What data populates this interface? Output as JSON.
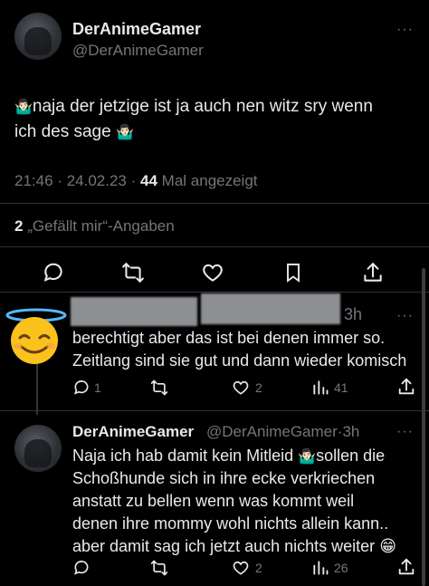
{
  "main_tweet": {
    "author_name": "DerAnimeGamer",
    "author_handle": "@DerAnimeGamer",
    "text_part1": "naja der jetzige ist ja auch nen witz sry wenn",
    "text_part2": "ich des sage",
    "emoji": "🤷🏻‍♂️",
    "time": "21:46",
    "date": "24.02.23",
    "views_count": "44",
    "views_label": "Mal angezeigt",
    "likes_count": "2",
    "likes_label": "„Gefällt mir“-Angaben",
    "separator": "·"
  },
  "reply_1": {
    "time": "3h",
    "line1": "berechtigt aber das ist bei denen immer so.",
    "line2": "Zeitlang sind sie gut und dann wieder komisch",
    "replies": "1",
    "likes": "2",
    "views": "41"
  },
  "reply_2": {
    "author_name": "DerAnimeGamer",
    "author_handle": "@DerAnimeGamer",
    "time": "3h",
    "line1": "Naja ich hab damit kein Mitleid",
    "line1b": "sollen die",
    "line2": "Schoßhunde sich in ihre ecke verkriechen",
    "line3": "anstatt zu bellen wenn was kommt weil",
    "line4": "denen ihre mommy wohl nichts allein kann..",
    "line5": "aber damit sag ich jetzt auch nichts weiter",
    "emoji_shrug": "🤷🏻‍♂️",
    "emoji_grin": "😁",
    "likes": "2",
    "views": "26"
  },
  "icons": {
    "more": "···",
    "reply": "reply-icon",
    "retweet": "retweet-icon",
    "like": "heart-icon",
    "bookmark": "bookmark-icon",
    "share": "share-icon",
    "views": "views-icon"
  },
  "colors": {
    "background": "#000000",
    "text": "#e7e9ea",
    "muted": "#71767b",
    "divider": "#2f3336"
  }
}
